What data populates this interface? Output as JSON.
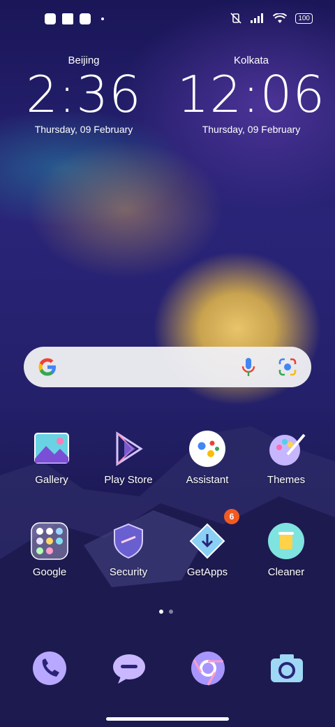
{
  "statusbar": {
    "left_icons": [
      "notification-app-icon",
      "notification-square-icon",
      "notification-app-icon-2"
    ],
    "right_icons": [
      "muted-vibrate-icon",
      "signal-icon",
      "wifi-icon"
    ],
    "battery": "100"
  },
  "clocks": [
    {
      "city": "Beijing",
      "time": "2:36",
      "date": "Thursday, 09 February"
    },
    {
      "city": "Kolkata",
      "time": "12:06",
      "date": "Thursday, 09 February"
    }
  ],
  "search": {
    "icons": [
      "google-g-icon",
      "microphone-icon",
      "lens-camera-icon"
    ]
  },
  "apps": {
    "row1": [
      {
        "label": "Gallery",
        "icon": "gallery-icon"
      },
      {
        "label": "Play Store",
        "icon": "play-store-icon"
      },
      {
        "label": "Assistant",
        "icon": "assistant-icon"
      },
      {
        "label": "Themes",
        "icon": "themes-icon"
      }
    ],
    "row2": [
      {
        "label": "Google",
        "icon": "google-folder-icon"
      },
      {
        "label": "Security",
        "icon": "security-shield-icon"
      },
      {
        "label": "GetApps",
        "icon": "getapps-icon",
        "badge": "6"
      },
      {
        "label": "Cleaner",
        "icon": "cleaner-icon"
      }
    ]
  },
  "page_indicator": {
    "pages": 2,
    "active": 1
  },
  "dock": [
    "phone-icon",
    "messages-icon",
    "browser-icon",
    "camera-icon"
  ],
  "colors": {
    "badge": "#f25a22",
    "wallpaper_sun": "#e8c46a",
    "wallpaper_sky": "#2a2478"
  }
}
